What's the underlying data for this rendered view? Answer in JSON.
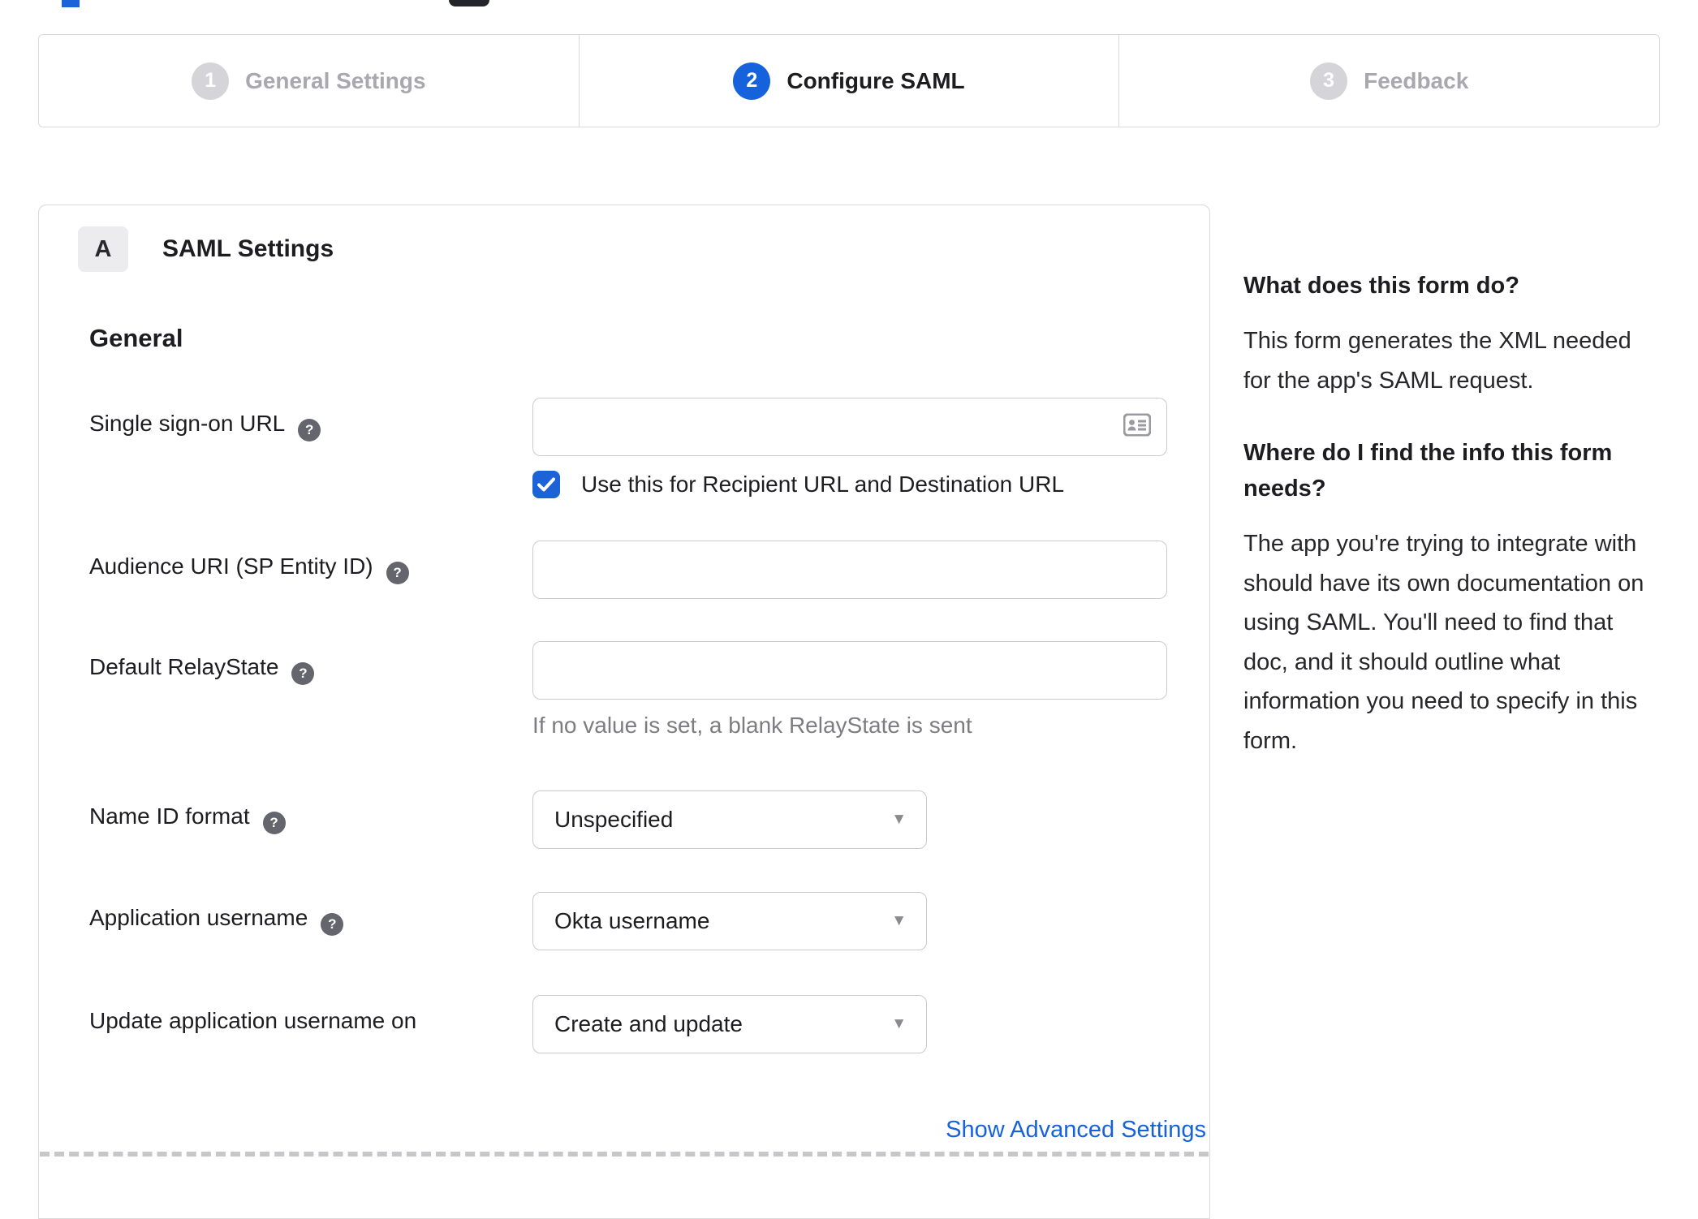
{
  "colors": {
    "accent_blue": "#1662dd",
    "checkbox_blue": "#1b63d6",
    "inactive_gray": "#d4d4d9",
    "border_gray": "#d9d9de",
    "helper_gray": "#7c7c82"
  },
  "stepper": {
    "steps": [
      {
        "number": "1",
        "label": "General Settings",
        "state": "inactive"
      },
      {
        "number": "2",
        "label": "Configure SAML",
        "state": "active"
      },
      {
        "number": "3",
        "label": "Feedback",
        "state": "inactive"
      }
    ]
  },
  "panel": {
    "badge": "A",
    "title": "SAML Settings",
    "section_title": "General",
    "fields": {
      "sso": {
        "label": "Single sign-on URL",
        "value": "",
        "checkbox_label": "Use this for Recipient URL and Destination URL",
        "checked": true
      },
      "audience": {
        "label": "Audience URI (SP Entity ID)",
        "value": ""
      },
      "relay": {
        "label": "Default RelayState",
        "value": "",
        "helper": "If no value is set, a blank RelayState is sent"
      },
      "nameid": {
        "label": "Name ID format",
        "value": "Unspecified"
      },
      "appuser": {
        "label": "Application username",
        "value": "Okta username"
      },
      "update": {
        "label": "Update application username on",
        "value": "Create and update"
      }
    },
    "advanced_link": "Show Advanced Settings"
  },
  "help": {
    "q1": "What does this form do?",
    "a1": "This form generates the XML needed for the app's SAML request.",
    "q2": "Where do I find the info this form needs?",
    "a2": "The app you're trying to integrate with should have its own documentation on using SAML. You'll need to find that doc, and it should outline what information you need to specify in this form."
  }
}
